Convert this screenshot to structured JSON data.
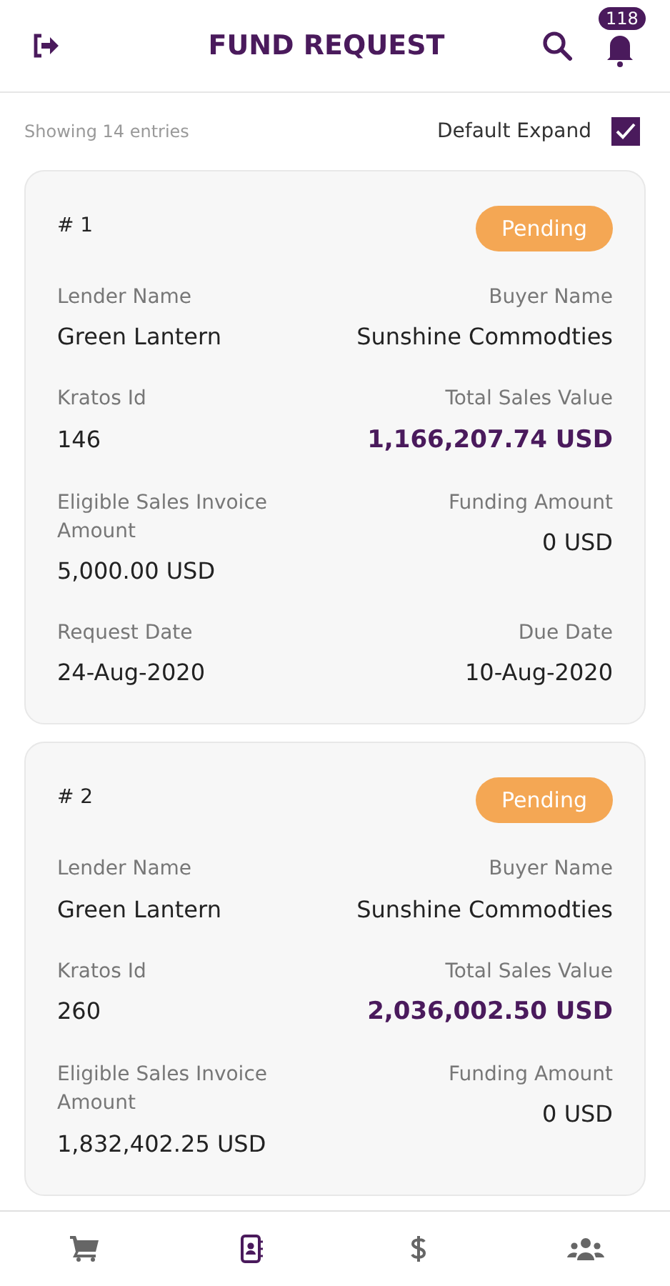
{
  "header": {
    "title": "FUND REQUEST",
    "notification_count": "118"
  },
  "toolbar": {
    "entries": "Showing 14 entries",
    "expand_label": "Default Expand",
    "expand_checked": true
  },
  "requests": [
    {
      "number": "# 1",
      "status": "Pending",
      "rows": [
        {
          "left": {
            "label": "Lender Name",
            "value": "Green Lantern",
            "highlight": false
          },
          "right": {
            "label": "Buyer Name",
            "value": "Sunshine Commodties",
            "highlight": false
          }
        },
        {
          "left": {
            "label": "Kratos Id",
            "value": "146",
            "highlight": false
          },
          "right": {
            "label": "Total Sales Value",
            "value": "1,166,207.74 USD",
            "highlight": true
          }
        },
        {
          "left": {
            "label": "Eligible Sales Invoice Amount",
            "value": "5,000.00 USD",
            "highlight": false
          },
          "right": {
            "label": "Funding Amount",
            "value": "0 USD",
            "highlight": false
          }
        },
        {
          "left": {
            "label": "Request Date",
            "value": "24-Aug-2020",
            "highlight": false
          },
          "right": {
            "label": "Due Date",
            "value": "10-Aug-2020",
            "highlight": false
          }
        }
      ]
    },
    {
      "number": "# 2",
      "status": "Pending",
      "rows": [
        {
          "left": {
            "label": "Lender Name",
            "value": "Green Lantern",
            "highlight": false
          },
          "right": {
            "label": "Buyer Name",
            "value": "Sunshine Commodties",
            "highlight": false
          }
        },
        {
          "left": {
            "label": "Kratos Id",
            "value": "260",
            "highlight": false
          },
          "right": {
            "label": "Total Sales Value",
            "value": "2,036,002.50 USD",
            "highlight": true
          }
        },
        {
          "left": {
            "label": "Eligible Sales Invoice Amount",
            "value": "1,832,402.25 USD",
            "highlight": false
          },
          "right": {
            "label": "Funding Amount",
            "value": "0 USD",
            "highlight": false
          }
        }
      ]
    }
  ],
  "nav": [
    {
      "kind": "cart",
      "selected": false
    },
    {
      "kind": "contacts",
      "selected": true
    },
    {
      "kind": "dollar",
      "selected": false
    },
    {
      "kind": "users",
      "selected": false
    }
  ]
}
